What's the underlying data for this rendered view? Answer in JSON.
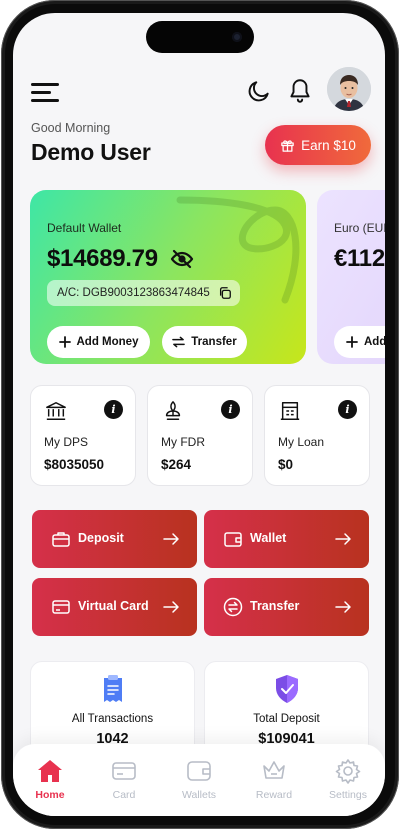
{
  "header": {
    "greeting": "Good Morning",
    "user_name": "Demo User",
    "earn_button": "Earn $10"
  },
  "wallets": [
    {
      "label": "Default Wallet",
      "balance": "$14689.79",
      "account": "A/C: DGB9003123863474845",
      "add_money": "Add Money",
      "transfer": "Transfer"
    },
    {
      "label": "Euro (EUR",
      "balance": "€112",
      "add_money": "Add"
    }
  ],
  "stats": [
    {
      "label": "My DPS",
      "value": "$8035050",
      "icon": "bank-icon"
    },
    {
      "label": "My FDR",
      "value": "$264",
      "icon": "plant-icon"
    },
    {
      "label": "My Loan",
      "value": "$0",
      "icon": "building-icon"
    }
  ],
  "actions": [
    {
      "label": "Deposit",
      "icon": "briefcase-icon"
    },
    {
      "label": "Wallet",
      "icon": "wallet-icon"
    },
    {
      "label": "Virtual Card",
      "icon": "card-icon"
    },
    {
      "label": "Transfer",
      "icon": "exchange-icon"
    }
  ],
  "summary": [
    {
      "label": "All Transactions",
      "value": "1042"
    },
    {
      "label": "Total Deposit",
      "value": "$109041"
    }
  ],
  "tabs": [
    {
      "label": "Home",
      "active": true
    },
    {
      "label": "Card",
      "active": false
    },
    {
      "label": "Wallets",
      "active": false
    },
    {
      "label": "Reward",
      "active": false
    },
    {
      "label": "Settings",
      "active": false
    }
  ],
  "colors": {
    "accent": "#e8324f",
    "action_start": "#d5304a",
    "action_end": "#b8321f",
    "wallet_gradient_start": "#3ee6a6",
    "wallet_gradient_end": "#c7e61a",
    "secondary_wallet": "#e6dafc"
  }
}
